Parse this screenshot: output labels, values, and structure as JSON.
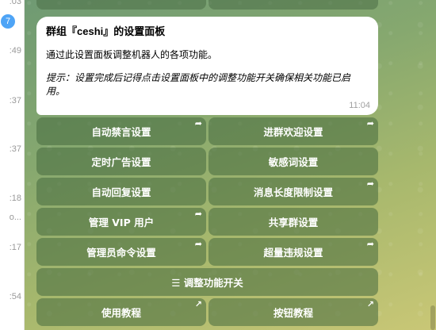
{
  "sidebar": {
    "times": [
      ":03",
      ":49",
      ":37",
      ":37",
      ":18",
      "o...",
      ":17",
      ":54"
    ],
    "unread_badge": "7"
  },
  "message": {
    "title": "群组『ceshi』的设置面板",
    "text": "通过此设置面板调整机器人的各项功能。",
    "hint": "提示：设置完成后记得点击设置面板中的调整功能开关确保相关功能已启用。",
    "time": "11:04"
  },
  "keyboard": {
    "rows": [
      [
        {
          "label": "自动禁言设置",
          "icon": "share-arrow-icon",
          "corner": "➦"
        },
        {
          "label": "进群欢迎设置",
          "icon": "share-arrow-icon",
          "corner": "➦"
        }
      ],
      [
        {
          "label": "定时广告设置",
          "icon": "",
          "corner": ""
        },
        {
          "label": "敏感词设置",
          "icon": "",
          "corner": ""
        }
      ],
      [
        {
          "label": "自动回复设置",
          "icon": "",
          "corner": ""
        },
        {
          "label": "消息长度限制设置",
          "icon": "share-arrow-icon",
          "corner": "➦"
        }
      ],
      [
        {
          "label": "管理 VIP 用户",
          "icon": "share-arrow-icon",
          "corner": "➦"
        },
        {
          "label": "共享群设置",
          "icon": "",
          "corner": ""
        }
      ],
      [
        {
          "label": "管理员命令设置",
          "icon": "share-arrow-icon",
          "corner": "➦"
        },
        {
          "label": "超量违规设置",
          "icon": "share-arrow-icon",
          "corner": "➦"
        }
      ],
      [
        {
          "label": "☰ 调整功能开关",
          "icon": "",
          "corner": ""
        }
      ],
      [
        {
          "label": "使用教程",
          "icon": "external-link-icon",
          "corner": "↗"
        },
        {
          "label": "按钮教程",
          "icon": "external-link-icon",
          "corner": "↗"
        }
      ]
    ]
  },
  "colors": {
    "button_bg": "#46693e",
    "badge": "#4ea4f6",
    "bubble_bg": "#ffffff"
  }
}
